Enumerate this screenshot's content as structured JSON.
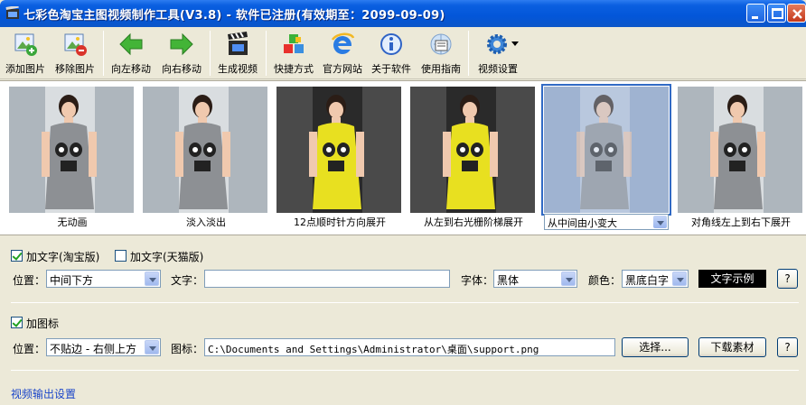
{
  "window": {
    "title": "七彩色淘宝主图视频制作工具(V3.8) - 软件已注册(有效期至：2099-09-09)"
  },
  "toolbar": {
    "buttons": [
      {
        "label": "添加图片",
        "icon": "add-image-icon"
      },
      {
        "label": "移除图片",
        "icon": "remove-image-icon"
      },
      {
        "label": "向左移动",
        "icon": "arrow-left-icon"
      },
      {
        "label": "向右移动",
        "icon": "arrow-right-icon"
      },
      {
        "label": "生成视频",
        "icon": "clapperboard-icon"
      },
      {
        "label": "快捷方式",
        "icon": "cubes-icon"
      },
      {
        "label": "官方网站",
        "icon": "ie-browser-icon"
      },
      {
        "label": "关于软件",
        "icon": "info-icon"
      },
      {
        "label": "使用指南",
        "icon": "guide-icon"
      },
      {
        "label": "视频设置",
        "icon": "gear-icon"
      }
    ]
  },
  "thumbnails": [
    {
      "caption": "无动画",
      "dress": "gray"
    },
    {
      "caption": "淡入淡出",
      "dress": "gray"
    },
    {
      "caption": "12点顺时针方向展开",
      "dress": "yellow"
    },
    {
      "caption": "从左到右光栅阶梯展开",
      "dress": "yellow"
    },
    {
      "caption": "从中间由小变大",
      "dress": "gray",
      "selected": true
    },
    {
      "caption": "对角线左上到右下展开",
      "dress": "gray"
    }
  ],
  "text_section": {
    "taobao_checkbox_label": "加文字(淘宝版)",
    "tmall_checkbox_label": "加文字(天猫版)",
    "position_label": "位置：",
    "position_value": "中间下方",
    "text_label": "文字：",
    "text_value": "",
    "font_label": "字体：",
    "font_value": "黑体",
    "color_label": "颜色：",
    "color_value": "黑底白字",
    "sample_label": "文字示例",
    "help_label": "?"
  },
  "icon_section": {
    "checkbox_label": "加图标",
    "position_label": "位置：",
    "position_value": "不贴边 - 右侧上方",
    "icon_label": "图标：",
    "icon_path": "C:\\Documents and Settings\\Administrator\\桌面\\support.png",
    "select_button": "选择...",
    "download_button": "下载素材",
    "help_label": "?"
  },
  "output": {
    "link_label": "视频输出设置"
  },
  "colors": {
    "titlebar": "#0356d9",
    "window_bg": "#ece9d8",
    "link": "#1a45c9",
    "yellow_dress": "#e8e020",
    "gray_dress": "#8d9094"
  }
}
